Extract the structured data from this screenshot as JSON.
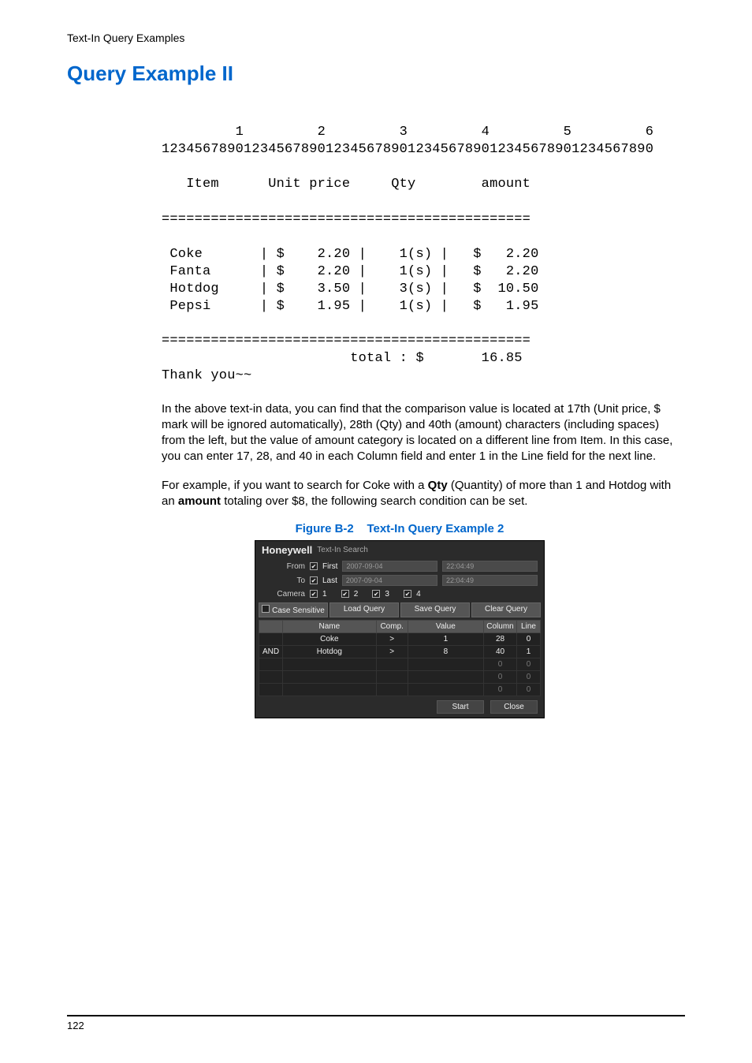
{
  "breadcrumb": "Text-In Query Examples",
  "heading": "Query Example II",
  "receipt": {
    "ruler_tens": "         1         2         3         4         5         6",
    "ruler_ones": "123456789012345678901234567890123456789012345678901234567890",
    "header": "   Item      Unit price     Qty        amount",
    "sep": "=============================================",
    "line1": " Coke       | $    2.20 |    1(s) |   $   2.20",
    "line2": " Fanta      | $    2.20 |    1(s) |   $   2.20",
    "line3": " Hotdog     | $    3.50 |    3(s) |   $  10.50",
    "line4": " Pepsi      | $    1.95 |    1(s) |   $   1.95",
    "total": "                       total : $       16.85",
    "thanks": "Thank you~~"
  },
  "para1_a": "In the above text-in data, you can find that the comparison value is located at 17th (Unit price, $ mark will be ignored automatically), 28th (Qty) and 40th (amount) characters (including spaces) from the left, but the value of amount category is located on a different line from Item. In this case, you can enter ",
  "para1_b": ", and ",
  "para1_c": " in each Column field and enter ",
  "para1_d": " in the Line field for the next line.",
  "cols": {
    "a": "17",
    "b": "28",
    "c": "40",
    "line": "1"
  },
  "para2_a": "For example, if you want to search for Coke with a ",
  "para2_b": " (Quantity) of more than 1 and Hotdog with an ",
  "para2_c": " totaling over $8, the following search condition can be set.",
  "qty": "Qty",
  "amount": "amount",
  "fig_caption_a": "Figure B-2",
  "fig_caption_b": "Text-In Query Example 2",
  "dialog": {
    "brand": "Honeywell",
    "title": "Text-In Search",
    "from": "From",
    "to": "To",
    "first": "First",
    "last": "Last",
    "date1": "2007-09-04",
    "time1": "22:04:49",
    "date2": "2007-09-04",
    "time2": "22:04:49",
    "camera": "Camera",
    "cam_nums": [
      "1",
      "2",
      "3",
      "4"
    ],
    "btn_case": "Case Sensitive",
    "btn_load": "Load Query",
    "btn_save": "Save Query",
    "btn_clear": "Clear Query",
    "hdr": [
      "",
      "Name",
      "Comp.",
      "Value",
      "Column",
      "Line"
    ],
    "row1": [
      "",
      "Coke",
      ">",
      "1",
      "28",
      "0"
    ],
    "row2": [
      "AND",
      "Hotdog",
      ">",
      "8",
      "40",
      "1"
    ],
    "empty3": [
      "",
      "",
      "",
      "",
      "0",
      "0"
    ],
    "empty4": [
      "",
      "",
      "",
      "",
      "0",
      "0"
    ],
    "empty5": [
      "",
      "",
      "",
      "",
      "0",
      "0"
    ],
    "start": "Start",
    "close": "Close"
  },
  "page_num": "122"
}
